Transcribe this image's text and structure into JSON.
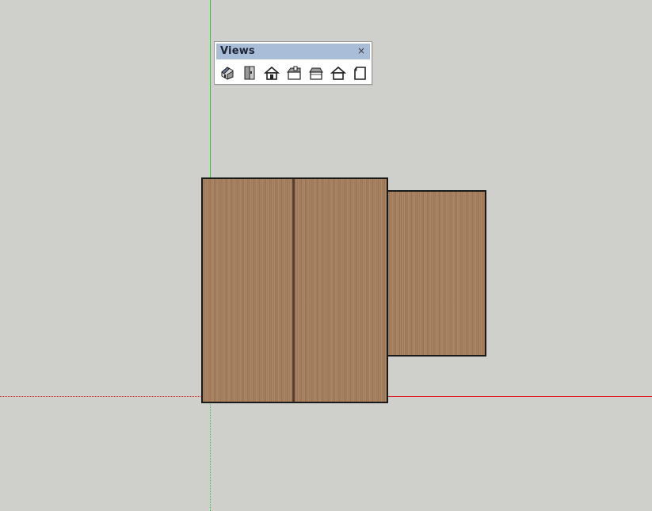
{
  "toolbar": {
    "title": "Views",
    "close_glyph": "×",
    "buttons": [
      {
        "name": "iso-view",
        "icon": "iso-house-icon"
      },
      {
        "name": "top-view",
        "icon": "top-view-icon"
      },
      {
        "name": "front-view",
        "icon": "front-house-icon"
      },
      {
        "name": "right-view",
        "icon": "right-house-icon"
      },
      {
        "name": "back-view",
        "icon": "back-house-icon"
      },
      {
        "name": "left-view",
        "icon": "left-house-icon"
      },
      {
        "name": "bottom-view",
        "icon": "bottom-view-icon"
      }
    ]
  },
  "axes": {
    "red": "#e02020",
    "green": "#3cc23c"
  },
  "model": {
    "material_color": "#a57e5c",
    "edge_color": "#1a1a1a"
  },
  "background_color": "#cfcfcb"
}
